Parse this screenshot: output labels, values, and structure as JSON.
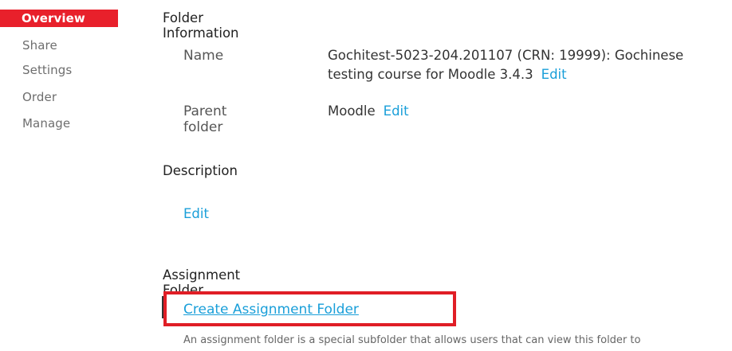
{
  "sidebar": {
    "items": [
      {
        "label": "Overview",
        "active": true
      },
      {
        "label": "Share"
      },
      {
        "label": "Settings"
      },
      {
        "label": "Order"
      },
      {
        "label": "Manage"
      }
    ]
  },
  "folder_info": {
    "heading": "Folder Information",
    "name_label": "Name",
    "name_line1": "Gochitest-5023-204.201107 (CRN: 19999): Gochinese",
    "name_line2": "testing course for Moodle 3.4.3",
    "name_edit": "Edit",
    "parent_label": "Parent folder",
    "parent_value": "Moodle",
    "parent_edit": "Edit"
  },
  "description": {
    "heading": "Description",
    "edit": "Edit"
  },
  "assignment": {
    "heading": "Assignment Folder",
    "create_link": "Create Assignment Folder",
    "help_text": "An assignment folder is a special subfolder that allows users that can view this folder to"
  },
  "colors": {
    "accent_red": "#e8202b",
    "link_blue": "#1a9fd9"
  }
}
